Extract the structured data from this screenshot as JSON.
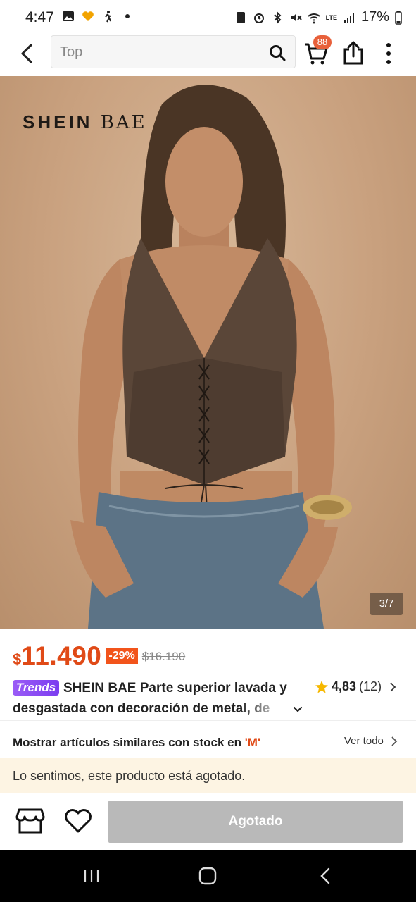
{
  "status_bar": {
    "time": "4:47",
    "battery": "17%",
    "network": "LTE"
  },
  "header": {
    "search_placeholder": "Top",
    "cart_count": "88"
  },
  "hero": {
    "brand_logo": {
      "part1": "SHEIN",
      "part2": "BAE"
    },
    "photo_counter": "3/7"
  },
  "product": {
    "currency": "$",
    "price": "11.490",
    "discount": "-29%",
    "old_price": "$16.190",
    "trends_badge": "Trends",
    "title": "SHEIN BAE Parte superior lavada y desgastada con decoración de metal, de",
    "rating_value": "4,83",
    "rating_count": "(12)"
  },
  "similar": {
    "label": "Mostrar artículos similares con stock en ",
    "size": "'M'",
    "link": "Ver todo"
  },
  "notice": {
    "text": "Lo sentimos, este producto está agotado."
  },
  "actions": {
    "soldout_label": "Agotado"
  },
  "colors": {
    "price": "#e04a17",
    "discount_bg": "#f2541b",
    "badge": "#e8603a",
    "notice_bg": "#fdf4e3",
    "disabled_button": "#b9b9b9"
  }
}
